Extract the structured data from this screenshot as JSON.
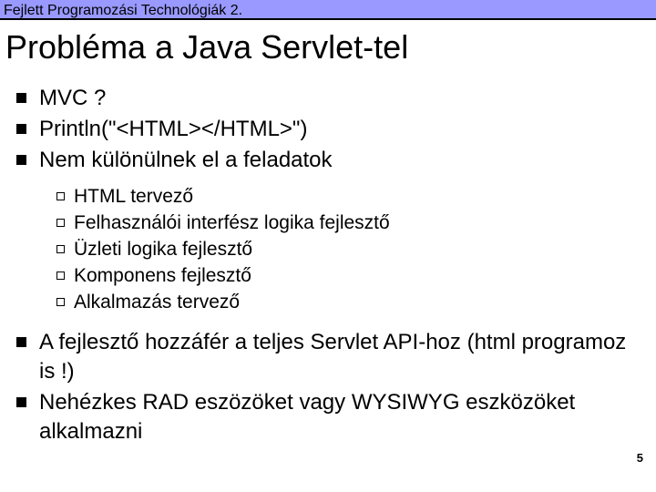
{
  "header": "Fejlett Programozási Technológiák 2.",
  "title": "Probléma a Java Servlet-tel",
  "bullets_top": [
    "MVC ?",
    "Println(\"<HTML></HTML>\")",
    "Nem különülnek el a feladatok"
  ],
  "sub_bullets": [
    "HTML tervező",
    "Felhasználói interfész logika fejlesztő",
    "Üzleti logika fejlesztő",
    "Komponens fejlesztő",
    "Alkalmazás tervező"
  ],
  "bullets_bottom": [
    "A fejlesztő hozzáfér a teljes Servlet API-hoz (html programoz is !)",
    "Nehézkes RAD eszözöket vagy WYSIWYG eszközöket alkalmazni"
  ],
  "page_number": "5"
}
